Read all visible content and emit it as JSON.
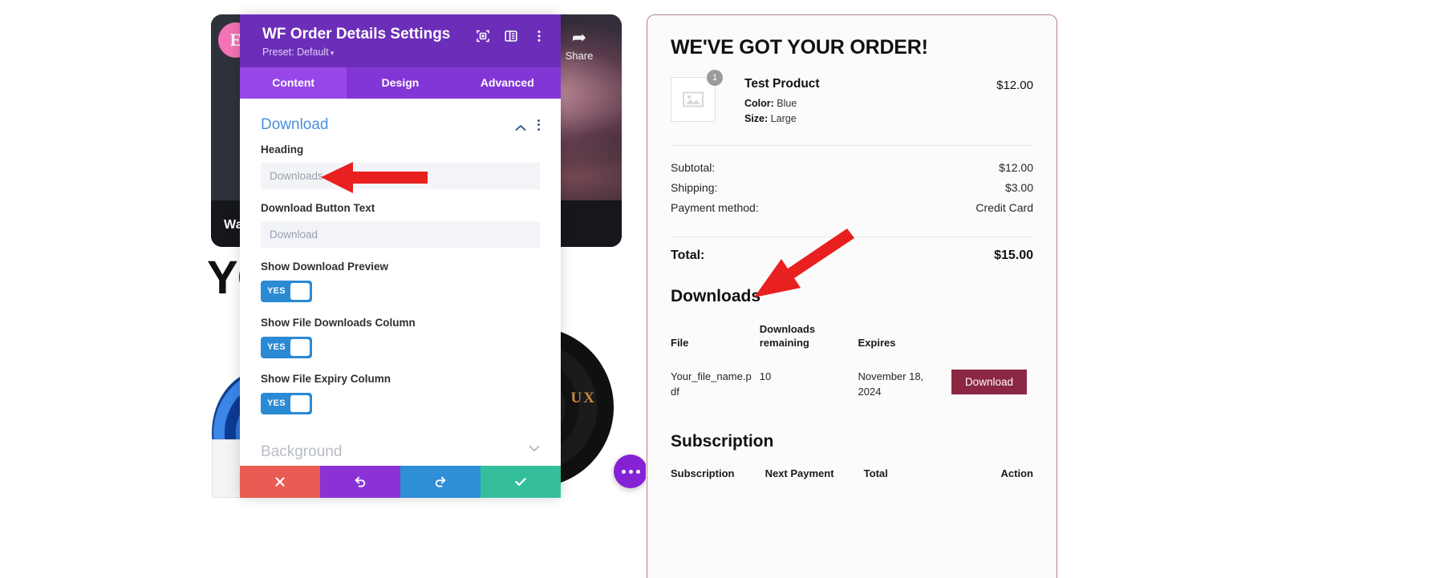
{
  "canvas": {
    "elementor_logo_letter": "E",
    "share_button": {
      "label": "Share",
      "icon": "share-icon",
      "glyph": "➦"
    },
    "watch_label": "Wat",
    "headline": "YO",
    "vinyl_text": "UX"
  },
  "panel": {
    "title": "WF Order Details Settings",
    "preset": "Preset: Default",
    "preset_caret": "▾",
    "header_icons": [
      {
        "name": "responsive-preview-icon"
      },
      {
        "name": "panel-layout-icon"
      },
      {
        "name": "more-options-icon"
      }
    ],
    "tabs": [
      {
        "label": "Content",
        "active": true
      },
      {
        "label": "Design",
        "active": false
      },
      {
        "label": "Advanced",
        "active": false
      }
    ],
    "section": {
      "title": "Download",
      "collapse_icon": "chevron-up-icon",
      "menu_icon": "kebab-menu-icon"
    },
    "fields": [
      {
        "label": "Heading",
        "value": "",
        "placeholder": "Downloads"
      },
      {
        "label": "Download Button Text",
        "value": "",
        "placeholder": "Download"
      }
    ],
    "toggles": [
      {
        "label": "Show Download Preview",
        "state": "YES"
      },
      {
        "label": "Show File Downloads Column",
        "state": "YES"
      },
      {
        "label": "Show File Expiry Column",
        "state": "YES"
      }
    ],
    "next_section": {
      "title": "Background"
    },
    "footer_buttons": [
      {
        "name": "cancel-button",
        "icon": "close-icon",
        "color": "#ea5b53"
      },
      {
        "name": "undo-button",
        "icon": "undo-icon",
        "color": "#8a32d6"
      },
      {
        "name": "redo-button",
        "icon": "redo-icon",
        "color": "#2e8ed6"
      },
      {
        "name": "save-button",
        "icon": "check-icon",
        "color": "#34bf9a"
      }
    ]
  },
  "order": {
    "title": "WE'VE GOT YOUR ORDER!",
    "product": {
      "name": "Test Product",
      "quantity": "1",
      "price": "$12.00",
      "attributes": [
        {
          "label": "Color:",
          "value": "Blue"
        },
        {
          "label": "Size:",
          "value": "Large"
        }
      ]
    },
    "totals": [
      {
        "label": "Subtotal:",
        "value": "$12.00"
      },
      {
        "label": "Shipping:",
        "value": "$3.00"
      },
      {
        "label": "Payment method:",
        "value": "Credit Card"
      }
    ],
    "grand_total": {
      "label": "Total:",
      "value": "$15.00"
    },
    "downloads": {
      "heading": "Downloads",
      "columns": [
        "File",
        "Downloads remaining",
        "Expires",
        ""
      ],
      "rows": [
        {
          "file": "Your_file_name.pdf",
          "remaining": "10",
          "expires": "November 18, 2024",
          "action": "Download"
        }
      ]
    },
    "subscription": {
      "heading": "Subscription",
      "columns": [
        "Subscription",
        "Next Payment",
        "Total",
        "Action"
      ]
    }
  },
  "colors": {
    "panel_header": "#6c2eb9",
    "panel_tabs": "#8336d6",
    "tab_active": "#9747e8",
    "section_title": "#4a8fe0",
    "toggle_on": "#2a8ad4",
    "download_button": "#8b2743",
    "card_border": "#b07e8e",
    "annotation_arrow": "#e8201f"
  }
}
